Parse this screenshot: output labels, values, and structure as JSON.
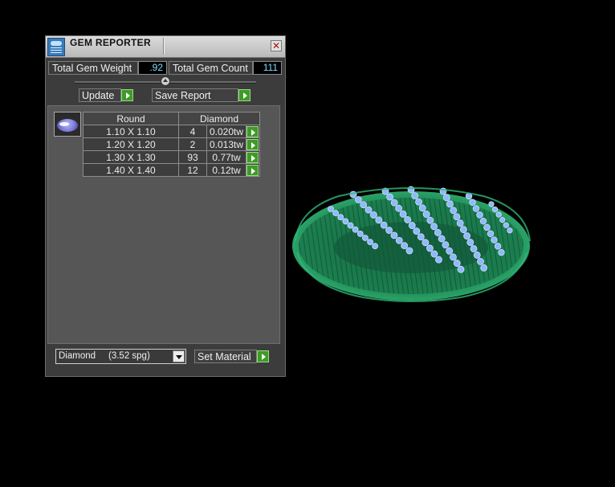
{
  "window": {
    "title": "GEM REPORTER",
    "close_icon": "close-icon"
  },
  "totals": {
    "weight_label": "Total Gem Weight",
    "weight_value": ".92",
    "count_label": "Total Gem Count",
    "count_value": "111"
  },
  "actions": {
    "update_label": "Update",
    "save_report_label": "Save Report"
  },
  "table": {
    "headers": [
      "Round",
      "Diamond"
    ],
    "rows": [
      {
        "size": "1.10 X 1.10",
        "count": "4",
        "weight": "0.020tw"
      },
      {
        "size": "1.20 X 1.20",
        "count": "2",
        "weight": "0.013tw"
      },
      {
        "size": "1.30 X 1.30",
        "count": "93",
        "weight": "0.77tw"
      },
      {
        "size": "1.40 X 1.40",
        "count": "12",
        "weight": "0.12tw"
      }
    ]
  },
  "material": {
    "selected": "Diamond     (3.52 spg)",
    "set_label": "Set Material"
  },
  "colors": {
    "accent_green": "#3f9a28",
    "value_text": "#7fdcff",
    "model_green": "#1f8a55",
    "gem_blue": "#8fb8ff"
  }
}
